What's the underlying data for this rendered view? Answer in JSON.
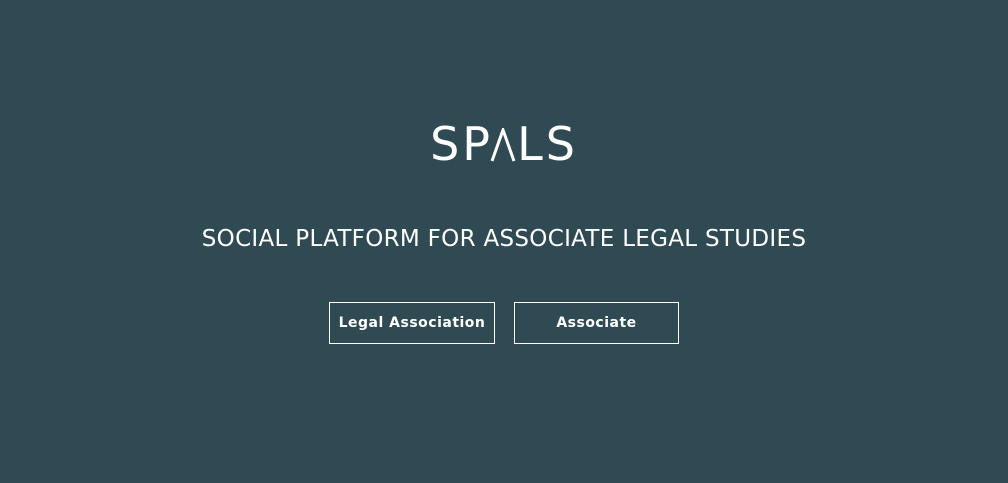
{
  "brand": {
    "logo_text": "SPALS",
    "logo_prefix": "SP",
    "logo_suffix": "LS"
  },
  "hero": {
    "tagline": "SOCIAL PLATFORM FOR ASSOCIATE LEGAL STUDIES"
  },
  "actions": {
    "legal_association_label": "Legal Association",
    "associate_label": "Associate"
  },
  "colors": {
    "background": "#2f4a53",
    "foreground": "#ffffff"
  }
}
